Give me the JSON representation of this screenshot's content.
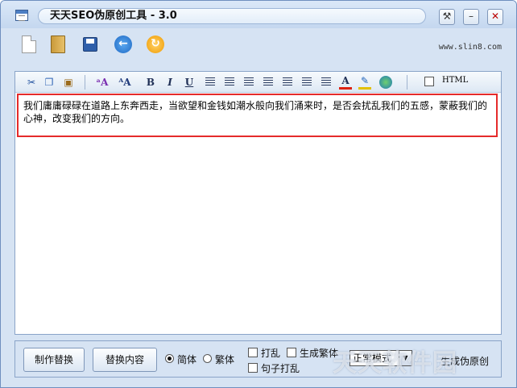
{
  "window": {
    "title": "天天SEO伪原创工具 - 3.0",
    "controls": {
      "settings": "⚒",
      "minimize": "–",
      "close": "✕"
    }
  },
  "toolbar": {
    "site": "www.slin8.com"
  },
  "editor": {
    "format_buttons": {
      "bold": "B",
      "italic": "I",
      "underline": "U",
      "font_color": "A",
      "html_label": "HTML"
    },
    "content": "我们庸庸碌碌在道路上东奔西走，当欲望和金钱如潮水般向我们涌来时，是否会扰乱我们的五感，蒙蔽我们的心神，改变我们的方向。"
  },
  "bottom": {
    "make_replace": "制作替换",
    "replace_content": "替换内容",
    "simplified": "简体",
    "traditional": "繁体",
    "shuffle": "打乱",
    "generate_traditional": "生成繁体",
    "sentence_shuffle": "句子打乱",
    "mode_selected": "正常模式",
    "generate_pseudo": "生成伪原创"
  },
  "watermark": "天天软件园"
}
